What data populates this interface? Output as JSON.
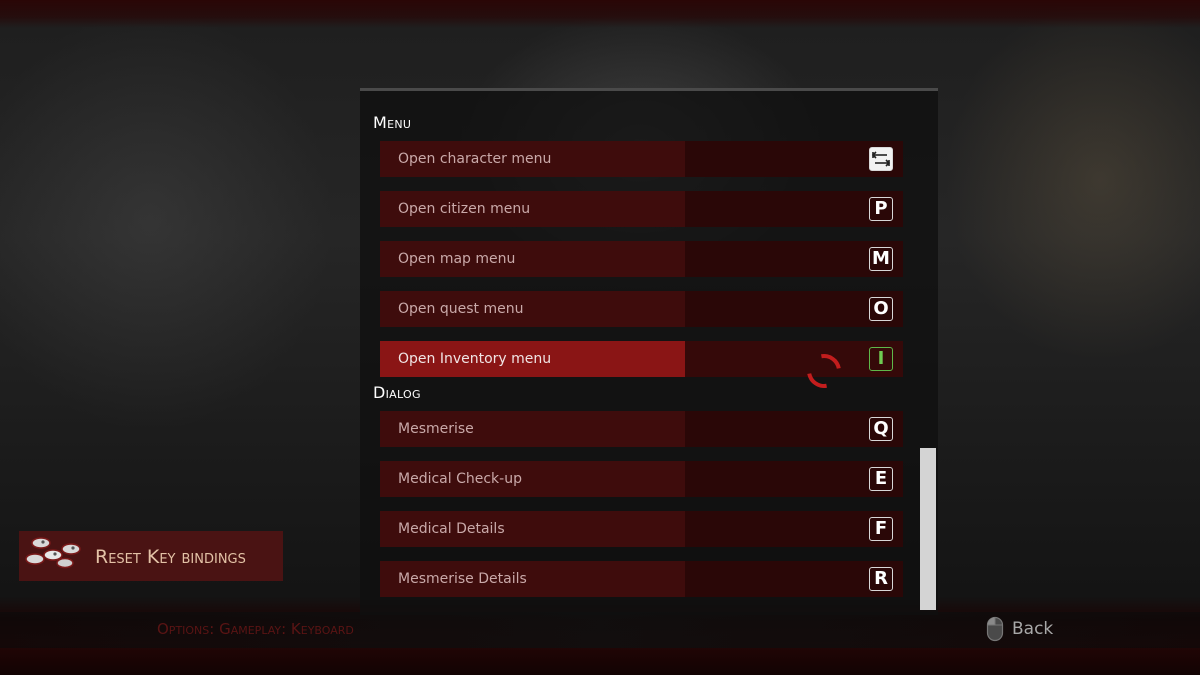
{
  "menu_section": {
    "title": "Menu",
    "items": [
      {
        "label": "Open character menu",
        "key": "⇆",
        "active": false
      },
      {
        "label": "Open citizen menu",
        "key": "P",
        "active": false
      },
      {
        "label": "Open map menu",
        "key": "M",
        "active": false
      },
      {
        "label": "Open quest menu",
        "key": "O",
        "active": false
      },
      {
        "label": "Open Inventory menu",
        "key": "I",
        "active": true
      }
    ]
  },
  "dialog_section": {
    "title": "Dialog",
    "items": [
      {
        "label": "Mesmerise",
        "key": "Q"
      },
      {
        "label": "Medical Check-up",
        "key": "E"
      },
      {
        "label": "Medical Details",
        "key": "F"
      },
      {
        "label": "Mesmerise Details",
        "key": "R"
      }
    ]
  },
  "reset_button": {
    "label": "Reset Key bindings",
    "icon": "gamepad-keys-icon"
  },
  "breadcrumb": "Options: Gameplay: Keyboard",
  "back": {
    "label": "Back",
    "icon": "mouse-icon"
  },
  "colors": {
    "accent": "#8a1515",
    "row": "#3e0c0c",
    "active_key": "#6fcb52"
  }
}
